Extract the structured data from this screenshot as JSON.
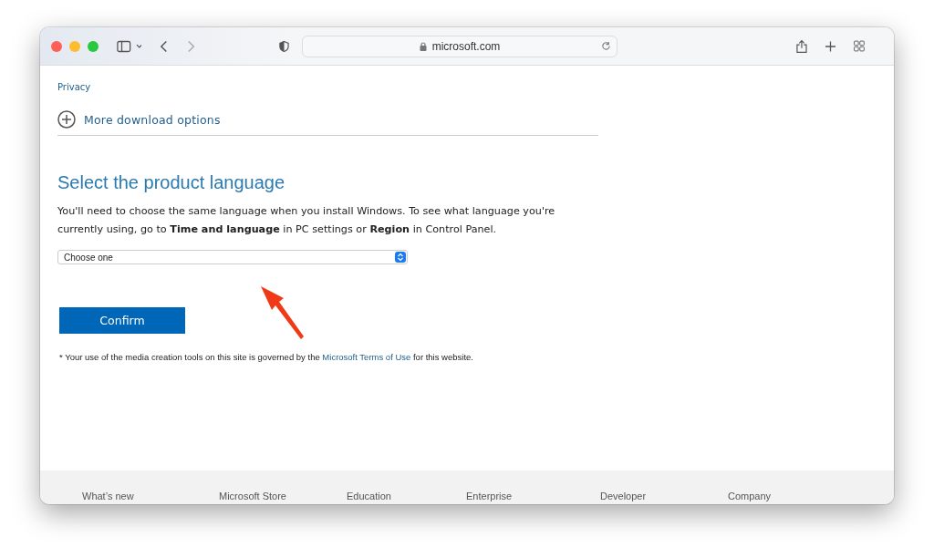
{
  "browser": {
    "address": "microsoft.com"
  },
  "page": {
    "privacy_link": "Privacy",
    "more_options": "More download options",
    "heading": "Select the product language",
    "description": "You'll need to choose the same language when you install Windows. To see what language you're currently using, go to **Time and language** in PC settings or **Region** in Control Panel.",
    "language_select": {
      "value": "Choose one"
    },
    "confirm_button": "Confirm",
    "terms_prefix": "* Your use of the media creation tools on this site is governed by the",
    "terms_link": "Microsoft Terms of Use",
    "terms_suffix": "for this website."
  },
  "footer": {
    "columns": [
      "What’s new",
      "Microsoft Store",
      "Education",
      "Enterprise",
      "Developer",
      "Company"
    ]
  }
}
